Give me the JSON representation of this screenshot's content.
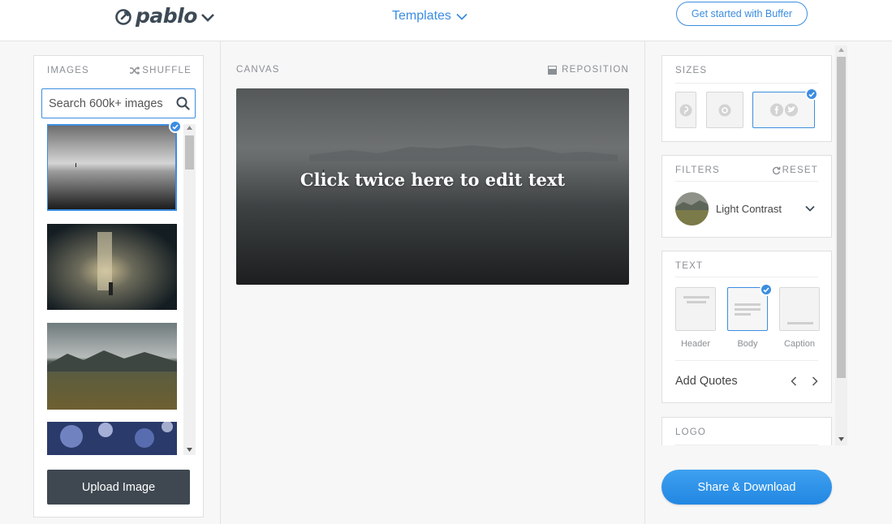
{
  "header": {
    "logo_text": "pablo",
    "templates_label": "Templates",
    "cta_label": "Get started with Buffer"
  },
  "images": {
    "title": "IMAGES",
    "shuffle_label": "SHUFFLE",
    "search_placeholder": "Search 600k+ images",
    "upload_label": "Upload Image"
  },
  "canvas": {
    "title": "CANVAS",
    "reposition_label": "REPOSITION",
    "text": "Click twice here to edit text"
  },
  "sizes": {
    "title": "SIZES",
    "options": [
      "pinterest-icon",
      "instagram-icon",
      "facebook-twitter-icon"
    ],
    "selected": "facebook-twitter"
  },
  "filters": {
    "title": "FILTERS",
    "reset_label": "RESET",
    "current": "Light Contrast"
  },
  "text_panel": {
    "title": "TEXT",
    "options": [
      "Header",
      "Body",
      "Caption"
    ],
    "selected": "Body",
    "quotes_label": "Add Quotes"
  },
  "logo_panel": {
    "title": "LOGO"
  },
  "share_label": "Share & Download",
  "colors": {
    "accent": "#3b8de0",
    "dark_button": "#3f4851"
  }
}
